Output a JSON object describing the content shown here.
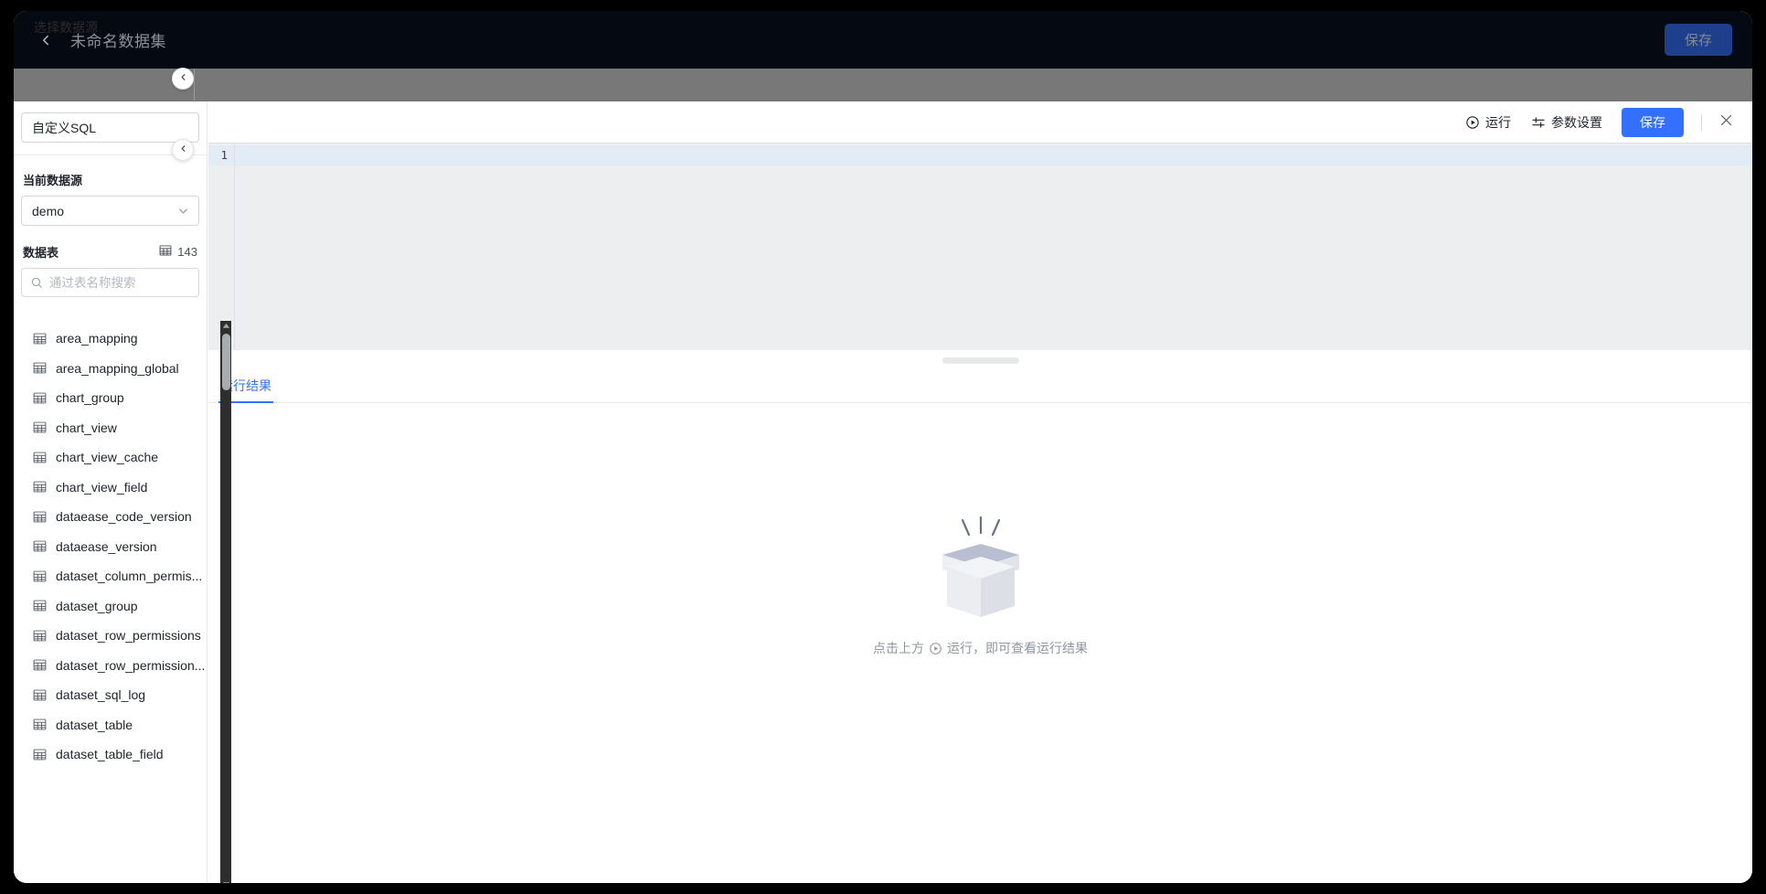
{
  "header": {
    "back_icon": "chevron-left-icon",
    "title": "未命名数据集",
    "save_label": "保存",
    "bg_color": "#050911",
    "save_bg_color": "#1d3f8c"
  },
  "scrim": {
    "label": "选择数据源",
    "collapse_icon": "chevron-left-icon",
    "bg_color": "#787878"
  },
  "sidebar": {
    "dataset_name_value": "自定义SQL",
    "datasource_label": "当前数据源",
    "datasource_value": "demo",
    "datasource_caret_icon": "chevron-down-icon",
    "tables_label": "数据表",
    "tables_count": "143",
    "tables_count_icon": "table-icon",
    "search_placeholder": "通过表名称搜索",
    "search_value": "",
    "search_icon": "search-icon",
    "tables": [
      {
        "name": "area_mapping",
        "icon": "table-icon"
      },
      {
        "name": "area_mapping_global",
        "icon": "table-icon"
      },
      {
        "name": "chart_group",
        "icon": "table-icon"
      },
      {
        "name": "chart_view",
        "icon": "table-icon"
      },
      {
        "name": "chart_view_cache",
        "icon": "table-icon"
      },
      {
        "name": "chart_view_field",
        "icon": "table-icon"
      },
      {
        "name": "dataease_code_version",
        "icon": "table-icon"
      },
      {
        "name": "dataease_version",
        "icon": "table-icon"
      },
      {
        "name": "dataset_column_permis...",
        "icon": "table-icon"
      },
      {
        "name": "dataset_group",
        "icon": "table-icon"
      },
      {
        "name": "dataset_row_permissions",
        "icon": "table-icon"
      },
      {
        "name": "dataset_row_permission...",
        "icon": "table-icon"
      },
      {
        "name": "dataset_sql_log",
        "icon": "table-icon"
      },
      {
        "name": "dataset_table",
        "icon": "table-icon"
      },
      {
        "name": "dataset_table_field",
        "icon": "table-icon"
      }
    ],
    "scrollbar": {
      "up_icon": "caret-up-icon",
      "down_icon": "caret-down-icon"
    }
  },
  "sql_pane": {
    "toolbar": {
      "run_label": "运行",
      "run_icon": "play-circle-icon",
      "params_label": "参数设置",
      "params_icon": "sliders-icon",
      "save_label": "保存",
      "close_icon": "close-icon",
      "save_bg_color": "#3370ff"
    },
    "editor": {
      "line_numbers": [
        "1"
      ],
      "code": "",
      "active_line_color": "#e3ecf6",
      "bg_color": "#eceef0"
    },
    "tabs": [
      {
        "label": "运行结果",
        "active": true
      }
    ],
    "empty_state": {
      "illustration": "empty-box-illustration",
      "text_before": "点击上方",
      "inline_icon": "play-circle-icon",
      "text_after": "运行，即可查看运行结果"
    }
  }
}
